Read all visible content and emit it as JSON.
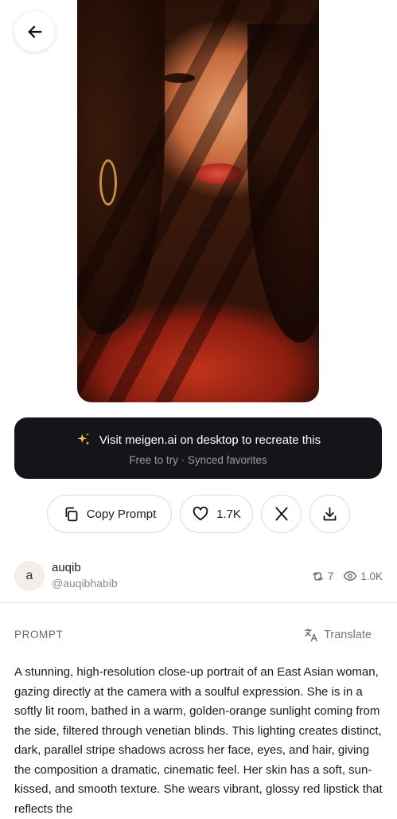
{
  "hero": {
    "image": "portrait-woman-venetian-light"
  },
  "promo": {
    "icon": "sparkles-icon",
    "title": "Visit meigen.ai on desktop to recreate this",
    "subtitle": "Free to try · Synced favorites"
  },
  "actions": {
    "copy_label": "Copy Prompt",
    "like_count": "1.7K"
  },
  "author": {
    "avatar_letter": "a",
    "name": "auqib",
    "handle": "@auqibhabib",
    "reposts": "7",
    "views": "1.0K"
  },
  "prompt": {
    "label": "PROMPT",
    "translate_label": "Translate",
    "text": "A stunning, high-resolution close-up portrait of an East Asian woman, gazing directly at the camera with a soulful expression. She is in a softly lit room, bathed in a warm, golden-orange sunlight coming from the side, filtered through venetian blinds. This lighting creates distinct, dark, parallel stripe shadows across her face, eyes, and hair, giving the composition a dramatic, cinematic feel. Her skin has a soft, sun-kissed, and smooth texture. She wears vibrant, glossy red lipstick that reflects the"
  },
  "colors": {
    "promo_bg": "#141518",
    "promo_sparkle": "#f5c542",
    "divider": "#e6e6e6"
  }
}
